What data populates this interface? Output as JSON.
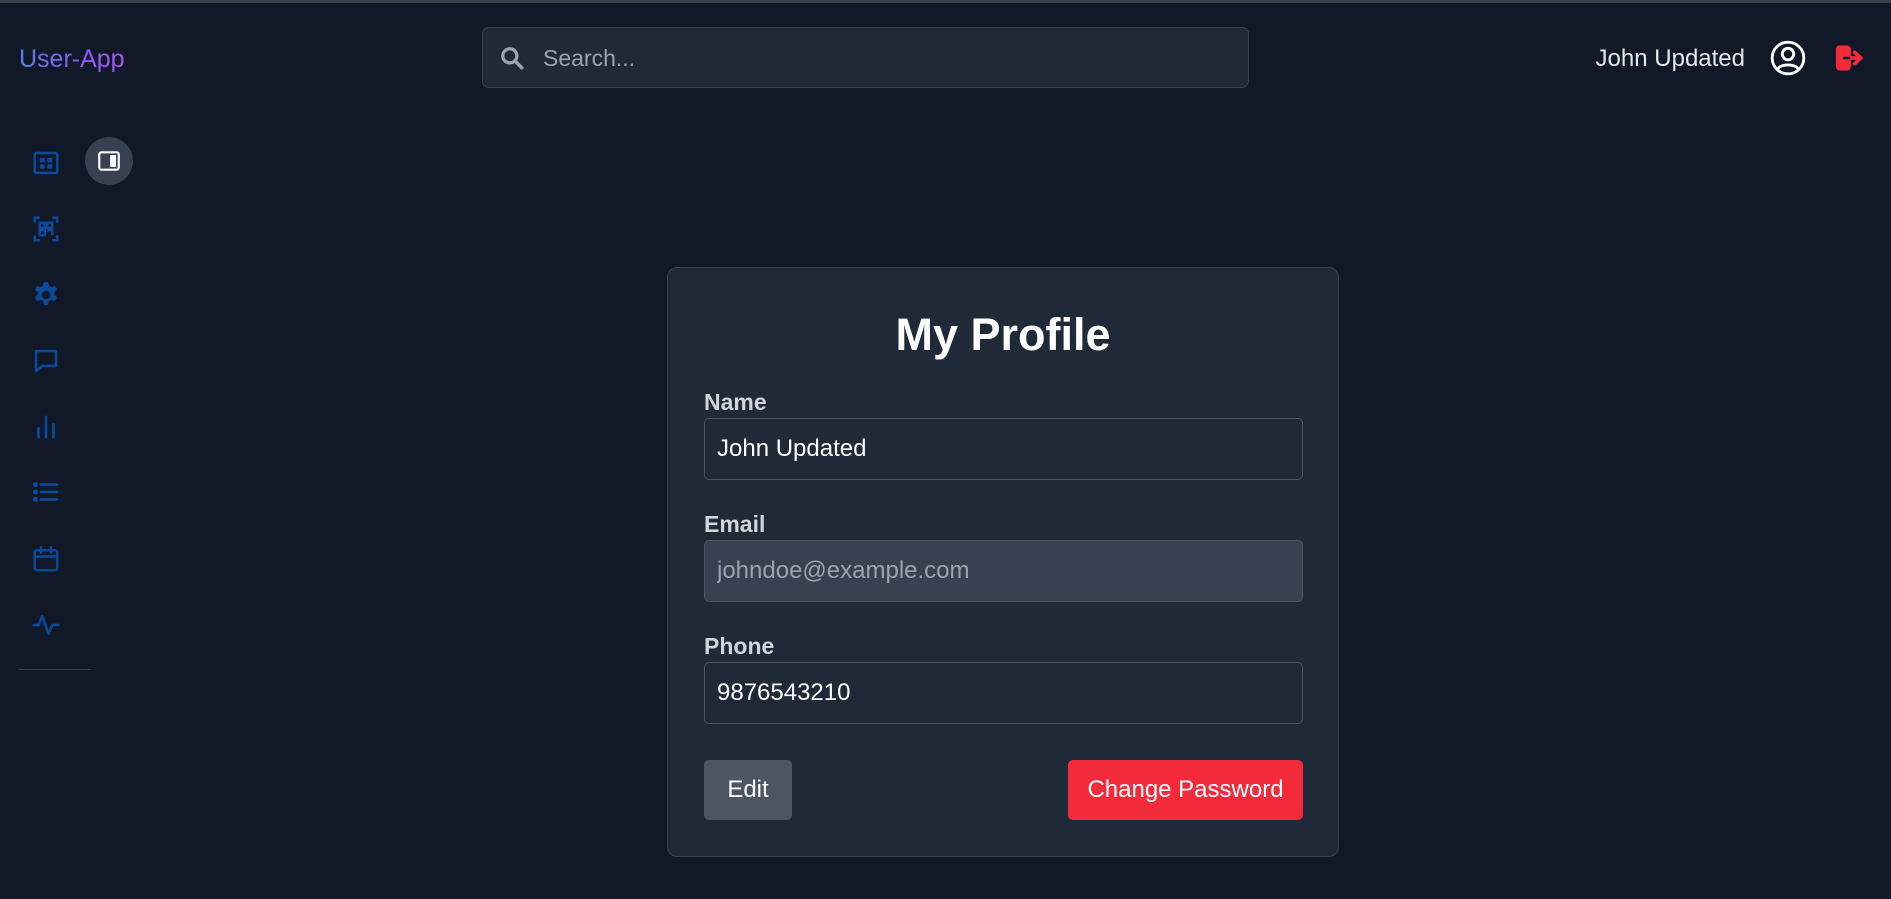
{
  "header": {
    "brand": "User-App",
    "search_placeholder": "Search...",
    "user_name": "John Updated",
    "user_icon": "user-circle-icon",
    "logout_icon": "logout-icon"
  },
  "sidebar": {
    "items": [
      {
        "icon": "dashboard-icon"
      },
      {
        "icon": "qr-scan-icon"
      },
      {
        "icon": "settings-icon"
      },
      {
        "icon": "chat-icon"
      },
      {
        "icon": "bar-chart-icon"
      },
      {
        "icon": "list-icon"
      },
      {
        "icon": "calendar-icon"
      },
      {
        "icon": "activity-icon"
      }
    ],
    "collapse_icon": "sidebar-toggle-icon"
  },
  "profile": {
    "title": "My Profile",
    "name_label": "Name",
    "name_value": "John Updated",
    "email_label": "Email",
    "email_value": "johndoe@example.com",
    "phone_label": "Phone",
    "phone_value": "9876543210",
    "edit_label": "Edit",
    "change_password_label": "Change Password"
  },
  "colors": {
    "background": "#111827",
    "card": "#1f2937",
    "accent_red": "#f22a3a",
    "sidebar_icon": "#0b4a9b",
    "brand_gradient_start": "#5b7cf0",
    "brand_gradient_end": "#a855f7"
  }
}
